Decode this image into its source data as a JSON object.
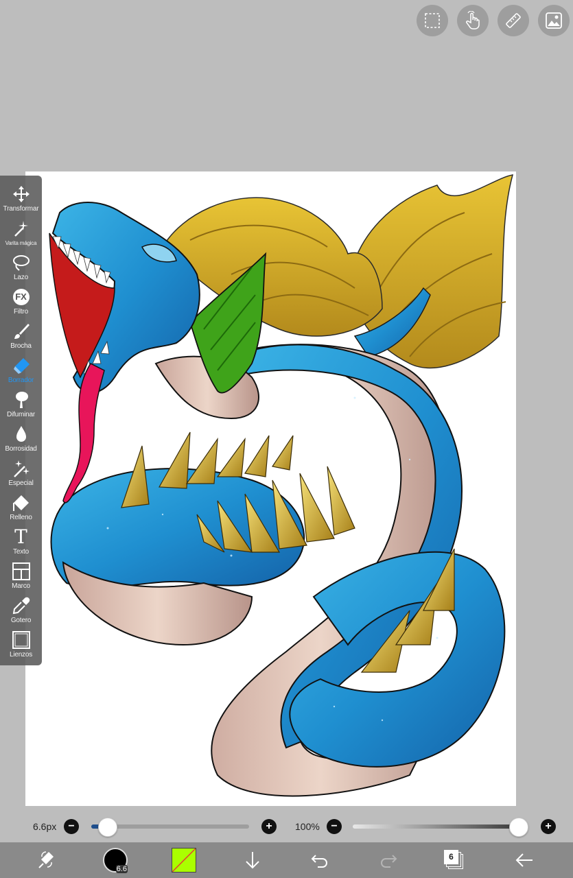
{
  "toolbar": {
    "tools": [
      {
        "label": "Transformar",
        "icon": "move-icon"
      },
      {
        "label": "Varita mágica",
        "icon": "magic-wand-icon"
      },
      {
        "label": "Lazo",
        "icon": "lasso-icon"
      },
      {
        "label": "Filtro",
        "icon": "fx-icon"
      },
      {
        "label": "Brocha",
        "icon": "brush-icon"
      },
      {
        "label": "Borrador",
        "icon": "eraser-icon",
        "active": true
      },
      {
        "label": "Difuminar",
        "icon": "smudge-icon"
      },
      {
        "label": "Borrosidad",
        "icon": "blur-drop-icon"
      },
      {
        "label": "Especial",
        "icon": "special-icon"
      },
      {
        "label": "Relleno",
        "icon": "fill-icon"
      },
      {
        "label": "Texto",
        "icon": "text-icon"
      },
      {
        "label": "Marco",
        "icon": "frame-icon"
      },
      {
        "label": "Gotero",
        "icon": "eyedropper-icon"
      },
      {
        "label": "Lienzos",
        "icon": "canvas-icon"
      }
    ],
    "fx_glyph": "FX",
    "text_glyph": "T"
  },
  "brush": {
    "size_text": "6.6px",
    "size_fraction": 0.1,
    "opacity_text": "100%",
    "opacity_fraction": 1.0,
    "badge_text": "6.6",
    "minus": "−",
    "plus": "+"
  },
  "bottom": {
    "layers_count": "6",
    "color_swatch": "#aaff00"
  },
  "colors": {
    "accent": "#2196f3",
    "toolbar_bg": "#5a5a5a",
    "workspace_bg": "#bdbdbd"
  }
}
